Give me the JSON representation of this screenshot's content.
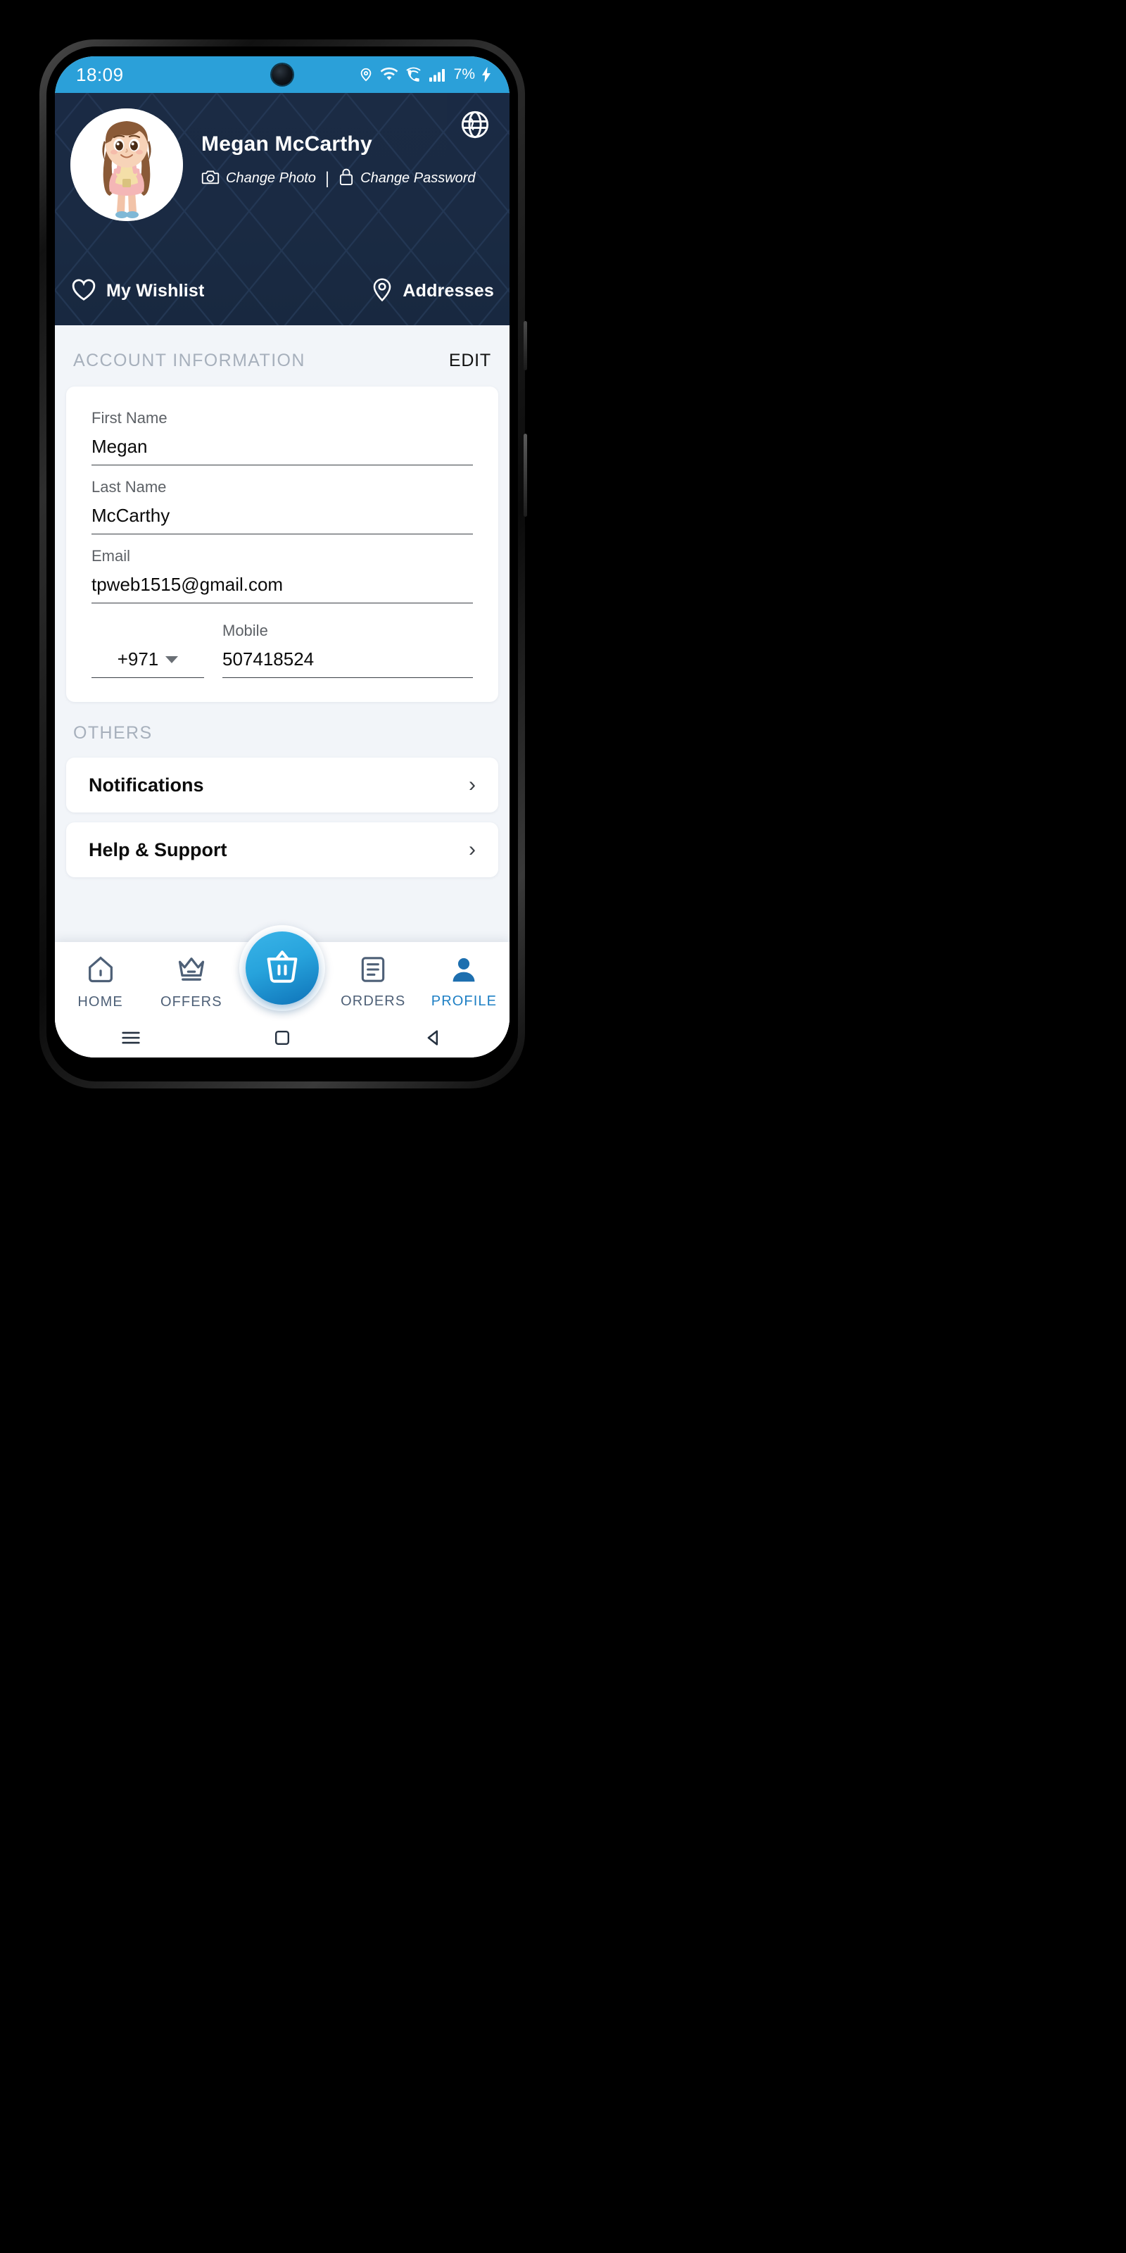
{
  "statusbar": {
    "time": "18:09",
    "battery": "7%",
    "icons": [
      "location-icon",
      "wifi-icon",
      "call-wifi-icon",
      "signal-bars-icon",
      "battery-icon",
      "charging-bolt-icon"
    ]
  },
  "header": {
    "user_name": "Megan McCarthy",
    "change_photo": "Change Photo",
    "divider": "|",
    "change_password": "Change Password",
    "globe_icon": "globe-icon",
    "camera_icon": "camera-icon",
    "lock_icon": "lock-icon",
    "background_color": "#1B2C45"
  },
  "quick_links": {
    "wishlist_label": "My Wishlist",
    "wishlist_icon": "heart-icon",
    "addresses_label": "Addresses",
    "addresses_icon": "location-pin-icon"
  },
  "account": {
    "section_title": "ACCOUNT INFORMATION",
    "edit_label": "EDIT",
    "fields": [
      {
        "label": "First Name",
        "value": "Megan"
      },
      {
        "label": "Last Name",
        "value": "McCarthy"
      },
      {
        "label": "Email",
        "value": "tpweb1515@gmail.com"
      }
    ],
    "mobile": {
      "label": "Mobile",
      "country_code": "+971",
      "number": "507418524"
    }
  },
  "others": {
    "section_title": "OTHERS",
    "items": [
      {
        "label": "Notifications",
        "chevron": "›"
      },
      {
        "label": "Help & Support",
        "chevron": "›"
      }
    ]
  },
  "bottom_nav": {
    "items": [
      {
        "label": "HOME",
        "icon": "home-icon"
      },
      {
        "label": "OFFERS",
        "icon": "crown-icon"
      },
      {
        "label": "ORDERS",
        "icon": "receipt-icon"
      },
      {
        "label": "PROFILE",
        "icon": "person-icon"
      }
    ],
    "fab_icon": "shopping-basket-icon",
    "active_index": 3,
    "active_color": "#1D7FC4"
  },
  "android_nav": {
    "menu_icon": "hamburger-icon",
    "home_icon": "square-home-icon",
    "back_icon": "triangle-back-icon"
  }
}
